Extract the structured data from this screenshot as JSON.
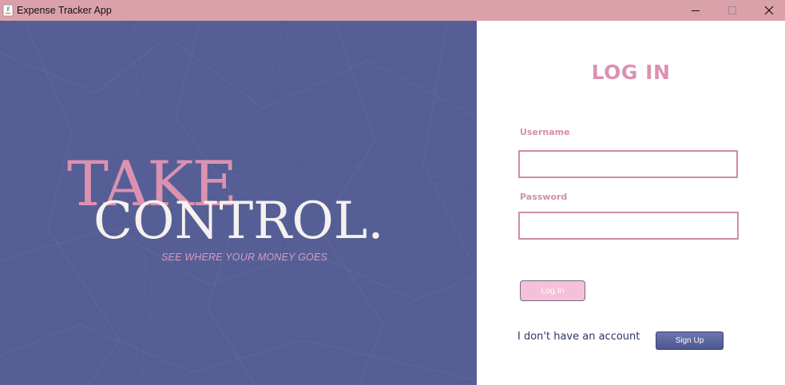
{
  "window": {
    "title": "Expense Tracker App",
    "controls": [
      "minimize-icon",
      "maximize-icon",
      "close-icon"
    ]
  },
  "hero": {
    "headline_top": "TAKE",
    "headline_bottom": "CONTROL.",
    "tagline": "SEE WHERE YOUR MONEY GOES",
    "colors": {
      "background": "#555f95",
      "take": "#dc91b1",
      "control": "#f6f1ee",
      "tagline": "#d99bc0"
    }
  },
  "login": {
    "title": "LOG IN",
    "username_label": "Username",
    "username_value": "",
    "password_label": "Password",
    "password_value": "",
    "login_button": "Log In",
    "no_account_text": "I don't have an account",
    "signup_button": "Sign Up",
    "colors": {
      "accent": "#dc91b1",
      "login_button": "#f8c0d8",
      "signup_button": "#555f95",
      "titlebar": "#dba1aa"
    }
  }
}
